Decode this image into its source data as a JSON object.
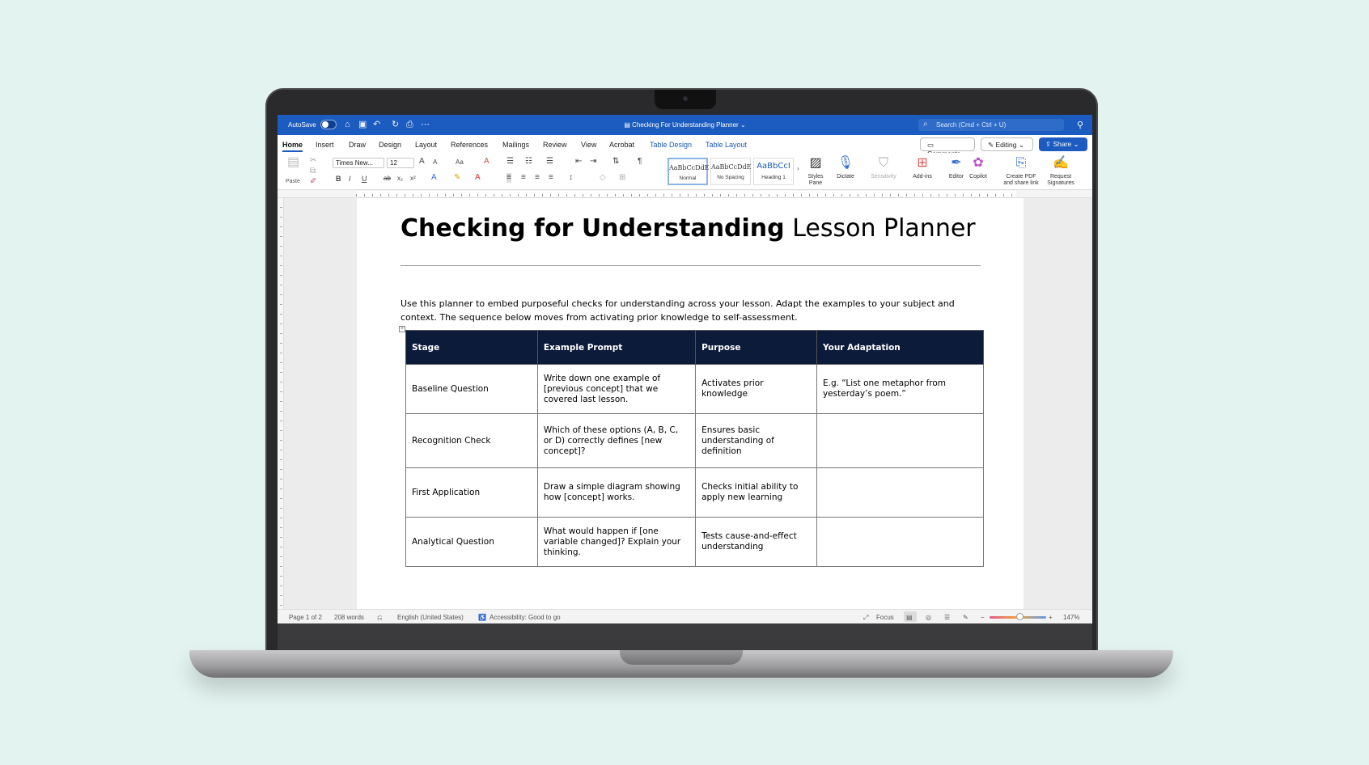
{
  "window": {
    "autosave_label": "AutoSave",
    "doc_title": "Checking For Understanding Planner",
    "search_placeholder": "Search (Cmd + Ctrl + U)"
  },
  "tabs": [
    "Home",
    "Insert",
    "Draw",
    "Design",
    "Layout",
    "References",
    "Mailings",
    "Review",
    "View",
    "Acrobat",
    "Table Design",
    "Table Layout"
  ],
  "right_buttons": {
    "comments": "Comments",
    "editing": "Editing",
    "share": "Share"
  },
  "ribbon": {
    "paste": "Paste",
    "font_name": "Times New...",
    "font_size": "12",
    "styles": [
      {
        "preview": "AaBbCcDdE",
        "name": "Normal"
      },
      {
        "preview": "AaBbCcDdE",
        "name": "No Spacing"
      },
      {
        "preview": "AaBbCcI",
        "name": "Heading 1"
      }
    ],
    "styles_pane": "Styles Pane",
    "dictate": "Dictate",
    "sensitivity": "Sensitivity",
    "addins": "Add-ins",
    "editor": "Editor",
    "copilot": "Copilot",
    "create_pdf": "Create PDF and share link",
    "request_signatures": "Request Signatures"
  },
  "document": {
    "title_bold": "Checking for Understanding",
    "title_rest": "Lesson Planner",
    "intro": "Use this planner to embed purposeful checks for understanding across your lesson. Adapt the examples to your subject and context. The sequence below moves from activating prior knowledge to self-assessment.",
    "table": {
      "headers": [
        "Stage",
        "Example Prompt",
        "Purpose",
        "Your Adaptation"
      ],
      "rows": [
        [
          "Baseline Question",
          "Write down one example of [previous concept] that we covered last lesson.",
          "Activates prior knowledge",
          "E.g. “List one metaphor from yesterday’s poem.”"
        ],
        [
          "Recognition Check",
          "Which of these options (A, B, C, or D) correctly defines [new concept]?",
          "Ensures basic understanding of definition",
          ""
        ],
        [
          "First Application",
          "Draw a simple diagram showing how [concept] works.",
          "Checks initial ability to apply new learning",
          ""
        ],
        [
          "Analytical Question",
          "What would happen if [one variable changed]? Explain your thinking.",
          "Tests cause-and-effect understanding",
          ""
        ]
      ]
    }
  },
  "status": {
    "page": "Page 1 of 2",
    "words": "208 words",
    "language": "English (United States)",
    "accessibility": "Accessibility: Good to go",
    "focus": "Focus",
    "zoom": "147%"
  }
}
